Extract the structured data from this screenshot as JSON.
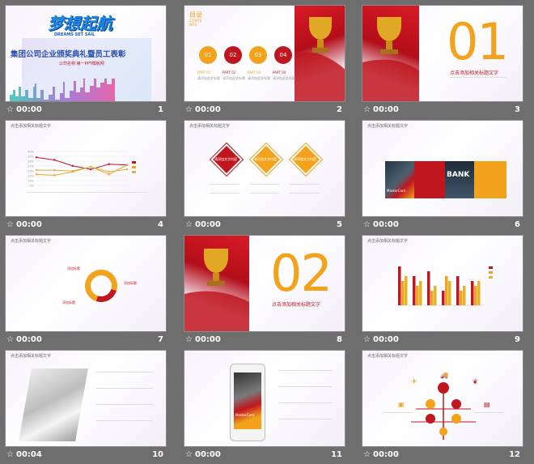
{
  "slides": [
    {
      "n": "1",
      "time": "00:00",
      "title": "梦想起航",
      "subtitle_en": "DREAMS SET SAIL",
      "heading": "集团公司企业颁奖典礼暨员工表彰",
      "company": "公司名称:第一PPT模板网"
    },
    {
      "n": "2",
      "time": "00:00",
      "toc": "目录",
      "toc_en": "CONTE NTS",
      "circles": [
        "01",
        "02",
        "03",
        "04"
      ],
      "parts": [
        "PART 01",
        "PART 02",
        "PART 03",
        "PART 04"
      ],
      "part_sub": "请添加此处标题"
    },
    {
      "n": "3",
      "time": "00:00",
      "num": "01",
      "caption": "点击添加相关标题文字"
    },
    {
      "n": "4",
      "time": "00:00",
      "header": "点击添加相关标题文字"
    },
    {
      "n": "5",
      "time": "00:00",
      "header": "点击添加相关标题文字",
      "diamond_text": "请添加文字内容"
    },
    {
      "n": "6",
      "time": "00:00",
      "header": "点击添加相关标题文字",
      "bank": "BANK",
      "card": "MasterCard"
    },
    {
      "n": "7",
      "time": "00:00",
      "header": "点击添加相关标题文字",
      "labels": [
        "添加标题",
        "添加标题",
        "添加标题"
      ]
    },
    {
      "n": "8",
      "time": "00:00",
      "num": "02",
      "caption": "点击添加相关标题文字"
    },
    {
      "n": "9",
      "time": "00:00",
      "header": "点击添加相关标题文字"
    },
    {
      "n": "10",
      "time": "00:04",
      "header": "点击添加相关标题文字"
    },
    {
      "n": "11",
      "time": "00:00",
      "card": "MasterCard"
    },
    {
      "n": "12",
      "time": "00:00",
      "header": "点击添加相关标题文字"
    }
  ],
  "colors": {
    "red": "#c0161f",
    "orange": "#f3a21b",
    "purple": "#9a7fd0"
  },
  "chart4": {
    "type": "line",
    "ylabels": [
      "40%",
      "35%",
      "30%",
      "25%",
      "20%",
      "15%",
      "10%",
      "5%"
    ],
    "series": [
      {
        "color": "#c0161f",
        "values": [
          33,
          30,
          23,
          19,
          25,
          24
        ]
      },
      {
        "color": "#f3a21b",
        "values": [
          13,
          12,
          16,
          22,
          13,
          24
        ]
      },
      {
        "color": "#d6b04a",
        "values": [
          18,
          18,
          17,
          22,
          16,
          19
        ]
      }
    ],
    "ylim": [
      0,
      40
    ]
  },
  "chart7": {
    "type": "pie",
    "values": [
      30,
      25,
      45
    ],
    "colors": [
      "#f3a21b",
      "#c0161f",
      "#f3a21b"
    ]
  },
  "chart9": {
    "type": "bar",
    "groups": [
      {
        "values": [
          8,
          5,
          6
        ]
      },
      {
        "values": [
          6,
          4,
          5
        ]
      },
      {
        "values": [
          7,
          3,
          4
        ]
      },
      {
        "values": [
          3,
          6,
          5
        ]
      },
      {
        "values": [
          6,
          3,
          4
        ]
      },
      {
        "values": [
          5,
          4,
          5
        ]
      }
    ],
    "colors": [
      "#c0161f",
      "#f3a21b",
      "#e2b42a"
    ],
    "ylim": [
      0,
      9
    ]
  }
}
